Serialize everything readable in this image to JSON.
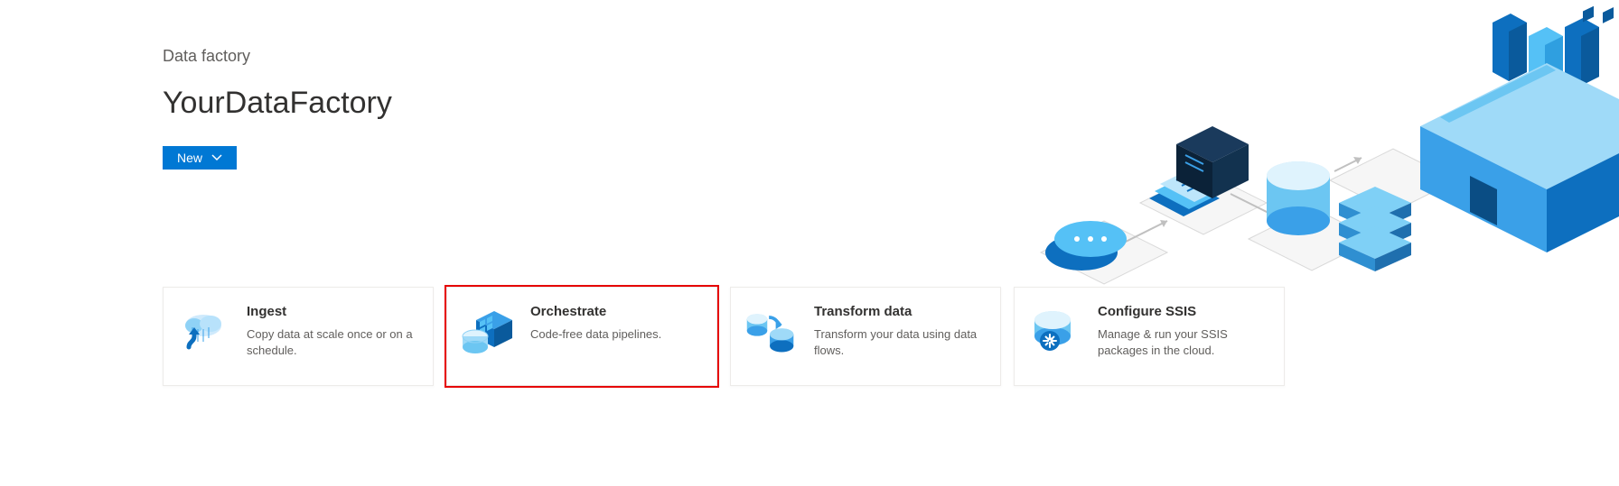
{
  "breadcrumb": "Data factory",
  "title": "YourDataFactory",
  "newButton": {
    "label": "New"
  },
  "cards": [
    {
      "id": "ingest",
      "title": "Ingest",
      "desc": "Copy data at scale once or on a schedule.",
      "highlight": false,
      "icon": "cloud-upload-icon"
    },
    {
      "id": "orchestrate",
      "title": "Orchestrate",
      "desc": "Code-free data pipelines.",
      "highlight": true,
      "icon": "pipeline-icon"
    },
    {
      "id": "transform",
      "title": "Transform data",
      "desc": "Transform your data using data flows.",
      "highlight": false,
      "icon": "data-flow-icon"
    },
    {
      "id": "ssis",
      "title": "Configure SSIS",
      "desc": "Manage & run your SSIS packages in the cloud.",
      "highlight": false,
      "icon": "ssis-icon"
    }
  ]
}
